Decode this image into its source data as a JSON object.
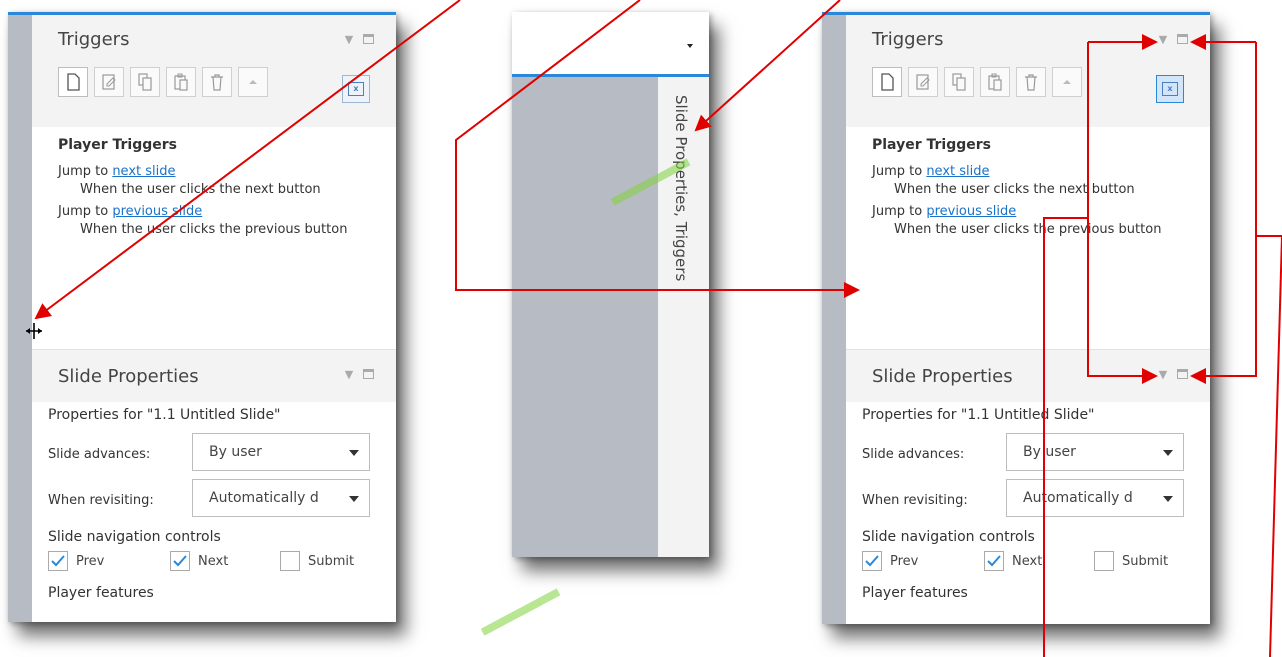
{
  "panels": [
    {
      "triggers_title": "Triggers",
      "player_triggers_title": "Player Triggers",
      "triggers": [
        {
          "action": "Jump to ",
          "target": "next slide",
          "condition": "When the user clicks the next button"
        },
        {
          "action": "Jump to ",
          "target": "previous slide",
          "condition": "When the user clicks the previous button"
        }
      ],
      "slide_properties_title": "Slide Properties",
      "properties_for": "Properties for \"1.1 Untitled Slide\"",
      "slide_advances_label": "Slide advances:",
      "slide_advances_value": "By user",
      "when_revisiting_label": "When revisiting:",
      "when_revisiting_value": "Automatically d",
      "nav_controls_title": "Slide navigation controls",
      "checkboxes": [
        {
          "label": "Prev",
          "checked": true
        },
        {
          "label": "Next",
          "checked": true
        },
        {
          "label": "Submit",
          "checked": false
        }
      ],
      "player_features_title": "Player features"
    },
    {
      "triggers_title": "Triggers",
      "player_triggers_title": "Player Triggers",
      "triggers": [
        {
          "action": "Jump to ",
          "target": "next slide",
          "condition": "When the user clicks the next button"
        },
        {
          "action": "Jump to ",
          "target": "previous slide",
          "condition": "When the user clicks the previous button"
        }
      ],
      "slide_properties_title": "Slide Properties",
      "properties_for": "Properties for \"1.1 Untitled Slide\"",
      "slide_advances_label": "Slide advances:",
      "slide_advances_value": "By user",
      "when_revisiting_label": "When revisiting:",
      "when_revisiting_value": "Automatically d",
      "nav_controls_title": "Slide navigation controls",
      "checkboxes": [
        {
          "label": "Prev",
          "checked": true
        },
        {
          "label": "Next",
          "checked": true
        },
        {
          "label": "Submit",
          "checked": false
        }
      ],
      "player_features_title": "Player features"
    }
  ],
  "collapsed_tab_label": "Slide Properties, Triggers",
  "toolbar_icons": [
    "new-trigger-icon",
    "edit-trigger-icon",
    "copy-icon",
    "paste-icon",
    "delete-icon",
    "move-up-icon"
  ],
  "colors": {
    "accent": "#2b88d8",
    "annotation_arrow": "#e00000",
    "link": "#1a73c9",
    "watermark": "#7fd33b"
  }
}
